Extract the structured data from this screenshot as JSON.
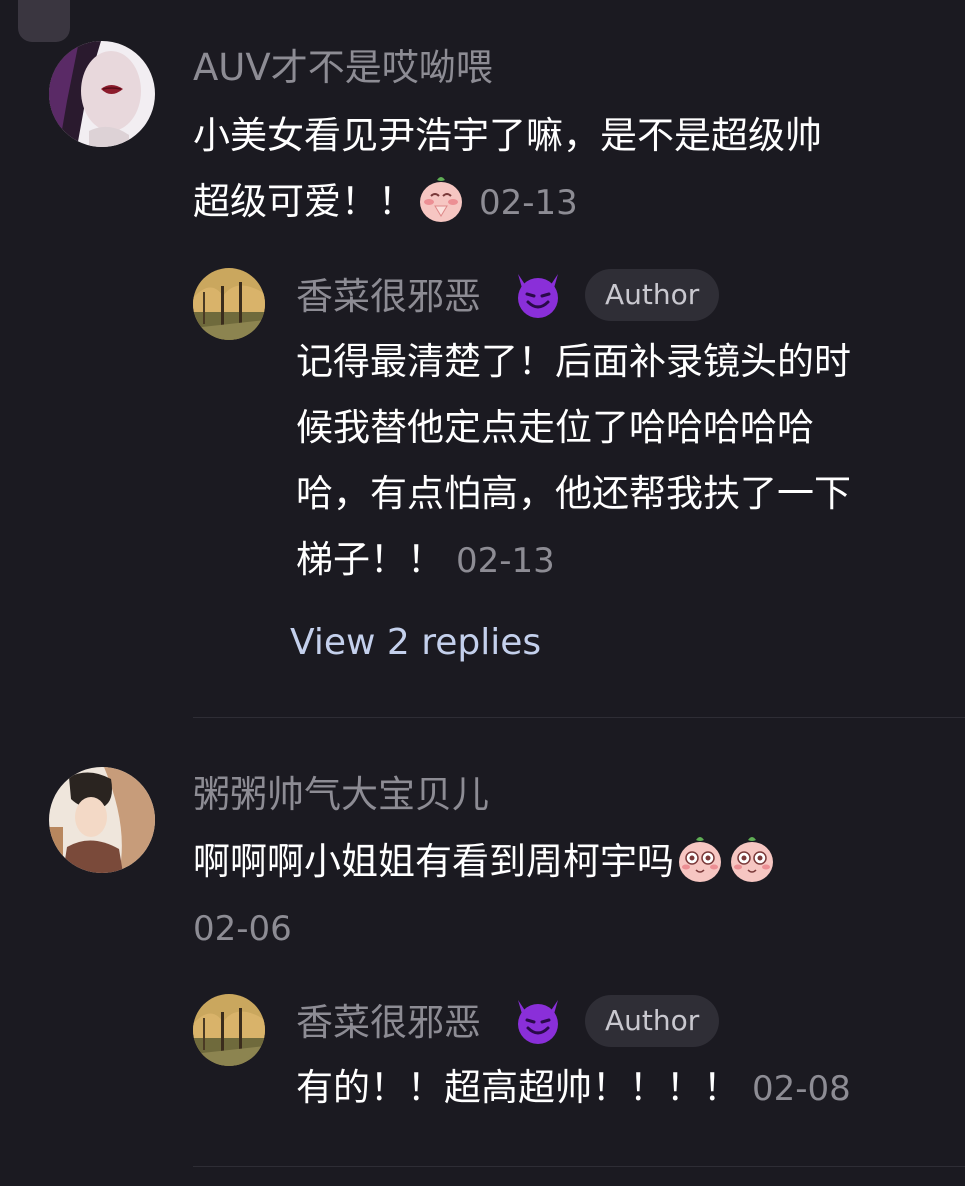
{
  "comments": [
    {
      "username": "AUV才不是哎呦喂",
      "text_line1": "小美女看见尹浩宇了嘛，是不是超级帅",
      "text_line2": "超级可爱！！",
      "emoji": "peach-pray-emoji",
      "date": "02-13",
      "reply": {
        "username": "香菜很邪恶",
        "username_emoji": "smiling-devil-emoji",
        "badge": "Author",
        "lines": [
          "记得最清楚了！后面补录镜头的时",
          "候我替他定点走位了哈哈哈哈哈",
          "哈，有点怕高，他还帮我扶了一下",
          "梯子！！"
        ],
        "date": "02-13"
      },
      "view_replies": "View 2 replies"
    },
    {
      "username": "粥粥帅气大宝贝儿",
      "text_line1": "啊啊啊小姐姐有看到周柯宇吗",
      "emoji": "peach-heart-eyes-emoji",
      "date": "02-06",
      "reply": {
        "username": "香菜很邪恶",
        "username_emoji": "smiling-devil-emoji",
        "badge": "Author",
        "text": "有的！！超高超帅！！！！",
        "date": "02-08"
      }
    }
  ],
  "colors": {
    "background": "#1b1a21",
    "username": "#8d8c94",
    "text": "#ffffff",
    "link": "#c4d0ec",
    "badge_bg": "#2f2e36",
    "devil": "#8a2fd9"
  }
}
